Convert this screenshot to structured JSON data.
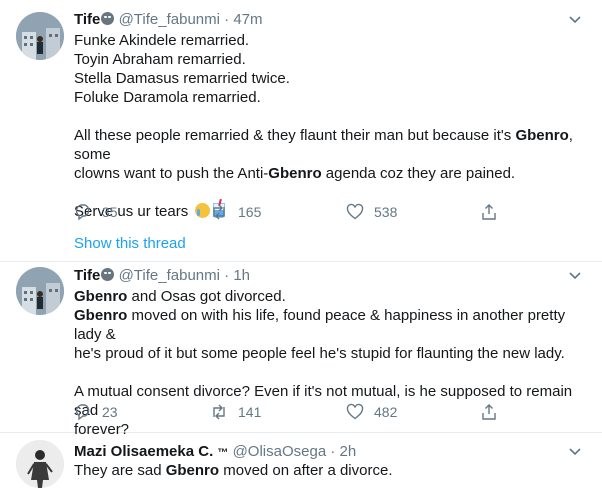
{
  "colors": {
    "accent": "#1da1f2",
    "muted": "#657786",
    "text": "#14171a",
    "divider": "#e6ecf0"
  },
  "tweets": [
    {
      "name": "Tife",
      "handle": "@Tife_fabunmi",
      "dot": "·",
      "time": "47m",
      "lines": [
        {
          "segments": [
            "Funke Akindele remarried."
          ]
        },
        {
          "segments": [
            "Toyin Abraham remarried."
          ]
        },
        {
          "segments": [
            "Stella Damasus remarried twice."
          ]
        },
        {
          "segments": [
            "Foluke Daramola remarried."
          ]
        },
        {
          "segments": [
            "All these people remarried & they flaunt their man but because it's ",
            "Gbenro",
            ", some"
          ]
        },
        {
          "segments": [
            "clowns want to push the Anti-",
            "Gbenro",
            " agenda coz they are pained."
          ]
        },
        {
          "segments": [
            "Serve us ur tears"
          ]
        }
      ],
      "replies": "35",
      "retweets": "165",
      "likes": "538",
      "thread_link": "Show this thread"
    },
    {
      "name": "Tife",
      "handle": "@Tife_fabunmi",
      "dot": "·",
      "time": "1h",
      "lines": [
        {
          "segments": [
            "Gbenro",
            " and Osas got divorced."
          ]
        },
        {
          "segments": [
            "Gbenro",
            " moved on with his life, found peace & happiness in another pretty lady &"
          ]
        },
        {
          "segments": [
            "he's proud of it but some people feel he's stupid for flaunting the new lady."
          ]
        },
        {
          "segments": [
            "A mutual consent divorce? Even if it's not mutual, is he supposed to remain sad"
          ]
        },
        {
          "segments": [
            "forever?"
          ]
        }
      ],
      "replies": "23",
      "retweets": "141",
      "likes": "482"
    },
    {
      "name": "Mazi Olisaemeka C.",
      "name_badge": "™",
      "handle": "@OlisaOsega",
      "dot": "·",
      "time": "2h",
      "lines": [
        {
          "segments": [
            "They are sad ",
            "Gbenro",
            " moved on after a divorce."
          ]
        }
      ]
    }
  ]
}
